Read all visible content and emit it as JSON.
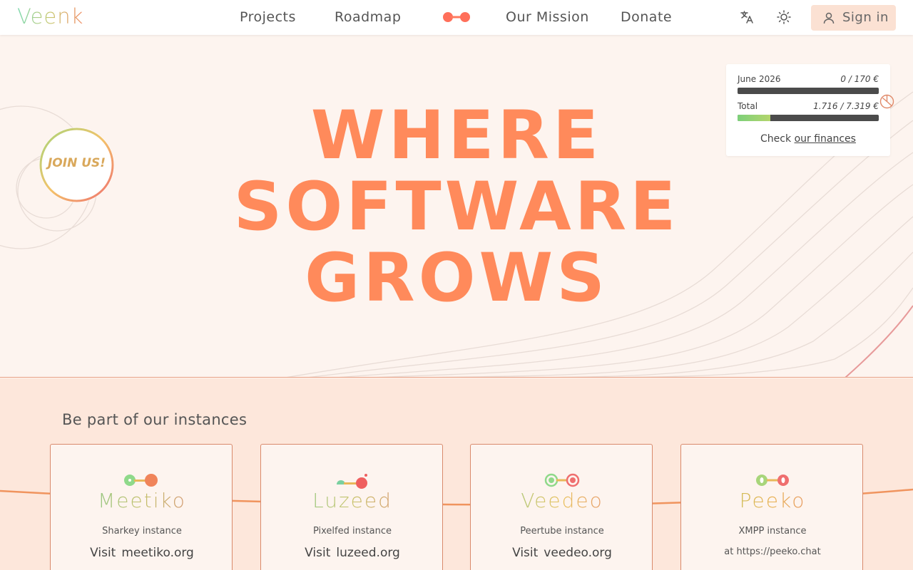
{
  "nav": {
    "logo": "Veenk",
    "items": [
      "Projects",
      "Roadmap",
      "Our Mission",
      "Donate"
    ],
    "signin_label": "Sign in"
  },
  "hero": {
    "headline_lines": [
      "WHERE",
      "SOFTWARE",
      "GROWS"
    ],
    "join_label": "JOIN US!"
  },
  "finance": {
    "month_label": "June 2026",
    "month_value": "0 / 170 €",
    "month_progress": 0.0,
    "total_label": "Total",
    "total_value": "1.716 / 7.319 €",
    "total_progress": 0.234,
    "check_prefix": "Check",
    "check_link": "our finances"
  },
  "instances": {
    "title": "Be part of our instances",
    "cards": [
      {
        "name": "Meetiko",
        "subtitle": "Sharkey instance",
        "visit_label": "Visit",
        "link": "meetiko.org"
      },
      {
        "name": "Luzeed",
        "subtitle": "Pixelfed instance",
        "visit_label": "Visit",
        "link": "luzeed.org"
      },
      {
        "name": "Veedeo",
        "subtitle": "Peertube instance",
        "visit_label": "Visit",
        "link": "veedeo.org"
      },
      {
        "name": "Peeko",
        "subtitle": "XMPP instance",
        "at_text": "at https://peeko.chat"
      }
    ]
  },
  "colors": {
    "accent": "#ff8a5b",
    "nav_bg": "#ffffff",
    "signin_bg": "#fbe1d3",
    "hero_bg": "#fdf4ef",
    "instances_bg": "#fde7db",
    "progress_track": "#4b4b4b",
    "progress_fill": "#7dd07a"
  },
  "icons": {
    "translate": "translate-icon",
    "theme": "sun-icon",
    "user": "user-icon",
    "finance": "pie-chart-icon"
  }
}
